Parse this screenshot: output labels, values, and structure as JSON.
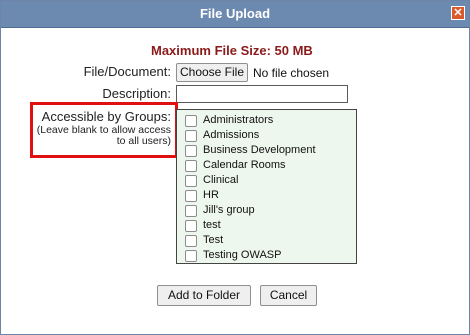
{
  "dialog": {
    "title": "File Upload",
    "close_glyph": "✕"
  },
  "form": {
    "max_size": "Maximum File Size: 50 MB",
    "file_label": "File/Document:",
    "choose_file_label": "Choose File",
    "no_file_text": "No file chosen",
    "description_label": "Description:",
    "description_value": "",
    "groups_label": "Accessible by Groups:",
    "groups_hint": "(Leave blank to allow access to all users)",
    "groups": [
      {
        "label": "Administrators",
        "checked": false
      },
      {
        "label": "Admissions",
        "checked": false
      },
      {
        "label": "Business Development",
        "checked": false
      },
      {
        "label": "Calendar Rooms",
        "checked": false
      },
      {
        "label": "Clinical",
        "checked": false
      },
      {
        "label": "HR",
        "checked": false
      },
      {
        "label": "Jill's group",
        "checked": false
      },
      {
        "label": "test",
        "checked": false
      },
      {
        "label": "Test",
        "checked": false
      },
      {
        "label": "Testing OWASP",
        "checked": false
      }
    ]
  },
  "actions": {
    "add_label": "Add to Folder",
    "cancel_label": "Cancel"
  },
  "colors": {
    "titlebar": "#6c89b0",
    "max_size_text": "#8b1a1a",
    "highlight_box": "#e01010",
    "list_background": "#eef7ee"
  }
}
